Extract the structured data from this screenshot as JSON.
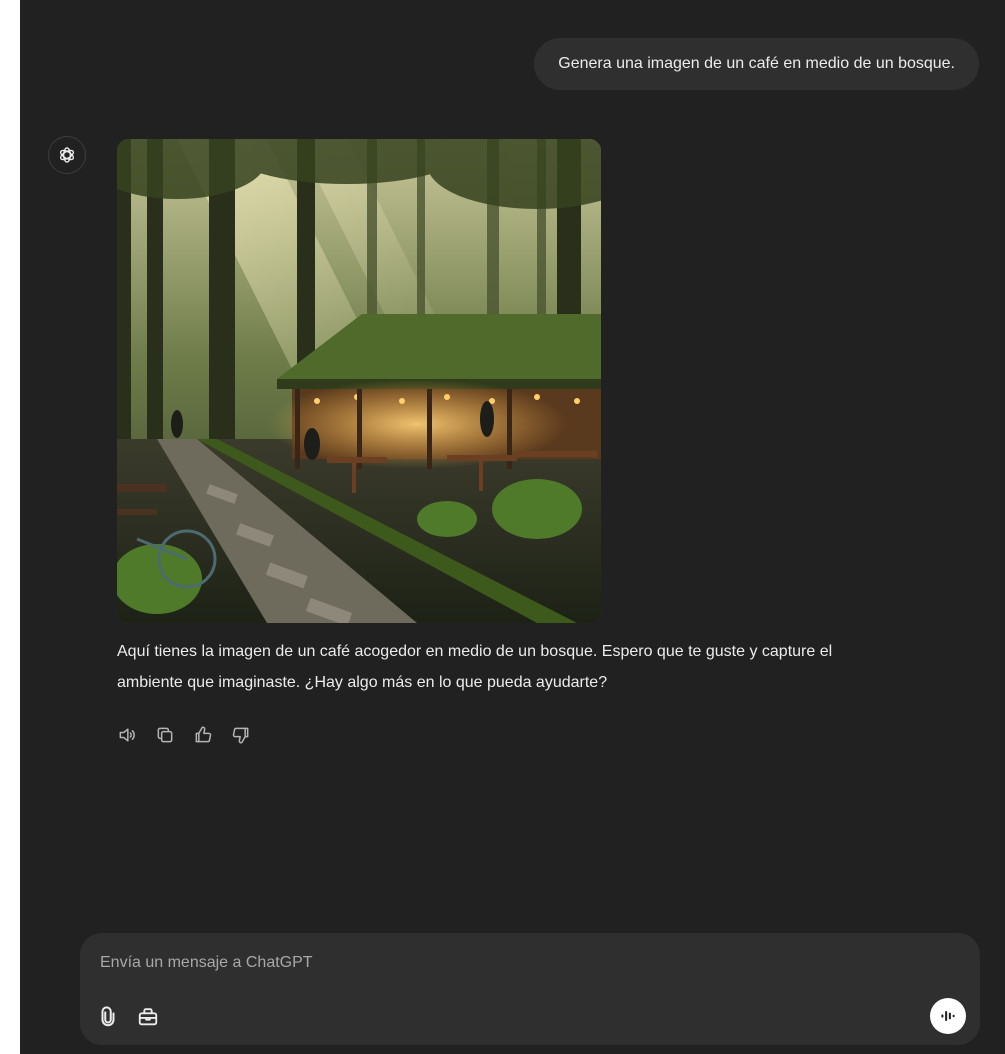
{
  "conversation": {
    "user_message": "Genera una imagen de un café en medio de un bosque.",
    "assistant": {
      "avatar_icon": "openai-logo-icon",
      "image_icon": "generated-image-forest-cafe",
      "reply_line_1": "Aquí tienes la imagen de un café acogedor en medio de un bosque. Espero que te guste y capture el",
      "reply_line_2": "ambiente que imaginaste. ¿Hay algo más en lo que pueda ayudarte?",
      "actions": [
        {
          "icon": "read-aloud-icon"
        },
        {
          "icon": "copy-icon"
        },
        {
          "icon": "thumbs-up-icon"
        },
        {
          "icon": "thumbs-down-icon"
        }
      ]
    }
  },
  "composer": {
    "placeholder": "Envía un mensaje a ChatGPT",
    "tools": [
      {
        "icon": "paperclip-icon"
      },
      {
        "icon": "toolbox-icon"
      }
    ],
    "voice_icon": "voice-mode-icon"
  },
  "colors": {
    "background": "#212121",
    "bubble": "#2f2f2f",
    "text": "#ececec",
    "placeholder": "#a8a8a8"
  }
}
